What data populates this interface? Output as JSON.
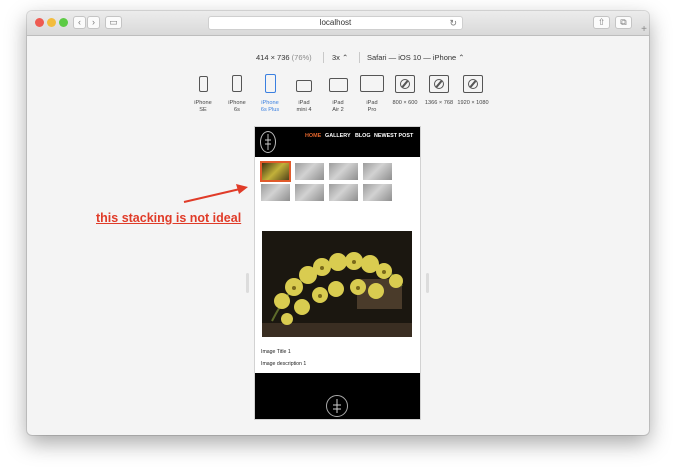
{
  "browser": {
    "url": "localhost",
    "colors": {
      "close": "#ee5b52",
      "minimize": "#f3bc3c",
      "zoom": "#5dcb45"
    }
  },
  "responsive": {
    "dimensions": "414 × 736",
    "zoom_pct": "(76%)",
    "pixel_ratio": "3x ⌃",
    "user_agent": "Safari — iOS 10 — iPhone ⌃",
    "devices": [
      {
        "line1": "iPhone",
        "line2": "SE"
      },
      {
        "line1": "iPhone",
        "line2": "6s"
      },
      {
        "line1": "iPhone",
        "line2": "6s Plus"
      },
      {
        "line1": "iPad",
        "line2": "mini 4"
      },
      {
        "line1": "iPad",
        "line2": "Air 2"
      },
      {
        "line1": "iPad",
        "line2": "Pro"
      },
      {
        "line1": "800 × 600",
        "line2": ""
      },
      {
        "line1": "1366 × 768",
        "line2": ""
      },
      {
        "line1": "1920 × 1080",
        "line2": ""
      }
    ],
    "active_device_index": 2,
    "accent_color": "#3a7fe0"
  },
  "annotation": {
    "text": "this stacking is not ideal",
    "color": "#e03b28"
  },
  "site": {
    "nav": [
      "HOME",
      "GALLERY",
      "BLOG",
      "NEWEST POST"
    ],
    "active_nav": "HOME",
    "active_color": "#e0642c",
    "thumbnail_count": 8,
    "selected_thumbnail": 0,
    "image_title": "Image Title 1",
    "image_description": "Image description 1"
  }
}
